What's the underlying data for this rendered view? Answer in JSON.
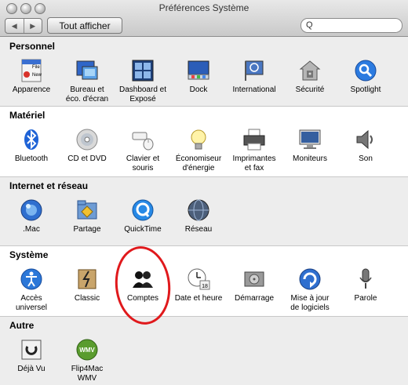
{
  "window": {
    "title": "Préférences Système"
  },
  "toolbar": {
    "back_label": "◀",
    "forward_label": "▶",
    "show_all_label": "Tout afficher",
    "search_placeholder": "",
    "search_icon": "Q"
  },
  "sections": {
    "personnel": {
      "title": "Personnel",
      "items": [
        {
          "label": "Apparence",
          "icon": "appearance-icon"
        },
        {
          "label": "Bureau et\néco. d'écran",
          "icon": "desktop-screensaver-icon"
        },
        {
          "label": "Dashboard et\nExposé",
          "icon": "dashboard-expose-icon"
        },
        {
          "label": "Dock",
          "icon": "dock-icon"
        },
        {
          "label": "International",
          "icon": "international-icon"
        },
        {
          "label": "Sécurité",
          "icon": "security-icon"
        },
        {
          "label": "Spotlight",
          "icon": "spotlight-icon"
        }
      ]
    },
    "materiel": {
      "title": "Matériel",
      "items": [
        {
          "label": "Bluetooth",
          "icon": "bluetooth-icon"
        },
        {
          "label": "CD et DVD",
          "icon": "cd-dvd-icon"
        },
        {
          "label": "Clavier et\nsouris",
          "icon": "keyboard-mouse-icon"
        },
        {
          "label": "Économiseur\nd'énergie",
          "icon": "energy-saver-icon"
        },
        {
          "label": "Imprimantes\net fax",
          "icon": "printer-fax-icon"
        },
        {
          "label": "Moniteurs",
          "icon": "displays-icon"
        },
        {
          "label": "Son",
          "icon": "sound-icon"
        }
      ]
    },
    "internet": {
      "title": "Internet et réseau",
      "items": [
        {
          "label": ".Mac",
          "icon": "dotmac-icon"
        },
        {
          "label": "Partage",
          "icon": "sharing-icon"
        },
        {
          "label": "QuickTime",
          "icon": "quicktime-icon"
        },
        {
          "label": "Réseau",
          "icon": "network-icon"
        }
      ]
    },
    "systeme": {
      "title": "Système",
      "items": [
        {
          "label": "Accès\nuniversel",
          "icon": "universal-access-icon"
        },
        {
          "label": "Classic",
          "icon": "classic-icon"
        },
        {
          "label": "Comptes",
          "icon": "accounts-icon"
        },
        {
          "label": "Date et heure",
          "icon": "date-time-icon"
        },
        {
          "label": "Démarrage",
          "icon": "startup-disk-icon"
        },
        {
          "label": "Mise à jour\nde logiciels",
          "icon": "software-update-icon"
        },
        {
          "label": "Parole",
          "icon": "speech-icon"
        }
      ]
    },
    "autre": {
      "title": "Autre",
      "items": [
        {
          "label": "Déjà Vu",
          "icon": "deja-vu-icon"
        },
        {
          "label": "Flip4Mac\nWMV",
          "icon": "flip4mac-icon"
        }
      ]
    }
  },
  "icon_texts": {
    "file": "File",
    "new": "New",
    "eighteen": "18",
    "wmv": "WMV"
  },
  "colors": {
    "annotation_circle": "#e0191c",
    "section_band": "#ededed"
  }
}
